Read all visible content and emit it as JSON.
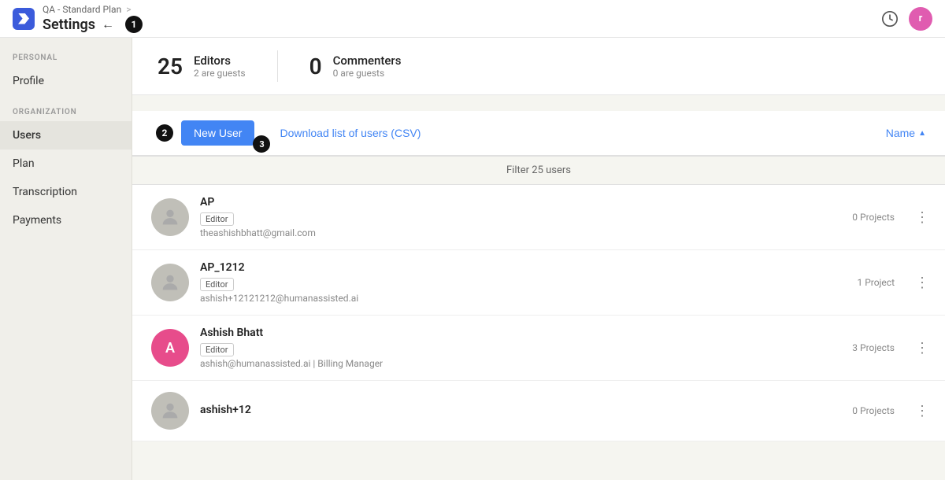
{
  "topbar": {
    "breadcrumb": "QA - Standard Plan",
    "breadcrumb_sep": ">",
    "title": "Settings",
    "back_icon": "←",
    "step1_badge": "1",
    "user_initial": "r"
  },
  "sidebar": {
    "personal_label": "PERSONAL",
    "organization_label": "ORGANIZATION",
    "items_personal": [
      {
        "id": "profile",
        "label": "Profile",
        "active": false
      }
    ],
    "items_org": [
      {
        "id": "users",
        "label": "Users",
        "active": true
      },
      {
        "id": "plan",
        "label": "Plan",
        "active": false
      },
      {
        "id": "transcription",
        "label": "Transcription",
        "active": false
      },
      {
        "id": "payments",
        "label": "Payments",
        "active": false
      }
    ]
  },
  "stats": {
    "editors_count": "25",
    "editors_label": "Editors",
    "editors_sub": "2 are guests",
    "commenters_count": "0",
    "commenters_label": "Commenters",
    "commenters_sub": "0 are guests"
  },
  "step2_badge": "2",
  "toolbar": {
    "new_user_label": "New User",
    "download_csv_label": "Download list of users (CSV)",
    "sort_name_label": "Name",
    "step3_badge": "3"
  },
  "filter": {
    "text": "Filter 25 users"
  },
  "users": [
    {
      "name": "AP",
      "role": "Editor",
      "email": "theashishbhatt@gmail.com",
      "projects": "0 Projects",
      "avatar_text": "",
      "avatar_color": "#c0bfb8"
    },
    {
      "name": "AP_1212",
      "role": "Editor",
      "email": "ashish+12121212@humanassisted.ai",
      "projects": "1 Project",
      "avatar_text": "",
      "avatar_color": "#c0bfb8"
    },
    {
      "name": "Ashish Bhatt",
      "role": "Editor",
      "email": "ashish@humanassisted.ai | Billing Manager",
      "projects": "3 Projects",
      "avatar_text": "A",
      "avatar_color": "#e74c8b"
    },
    {
      "name": "ashish+12",
      "role": "",
      "email": "",
      "projects": "0 Projects",
      "avatar_text": "",
      "avatar_color": "#c0bfb8"
    }
  ]
}
